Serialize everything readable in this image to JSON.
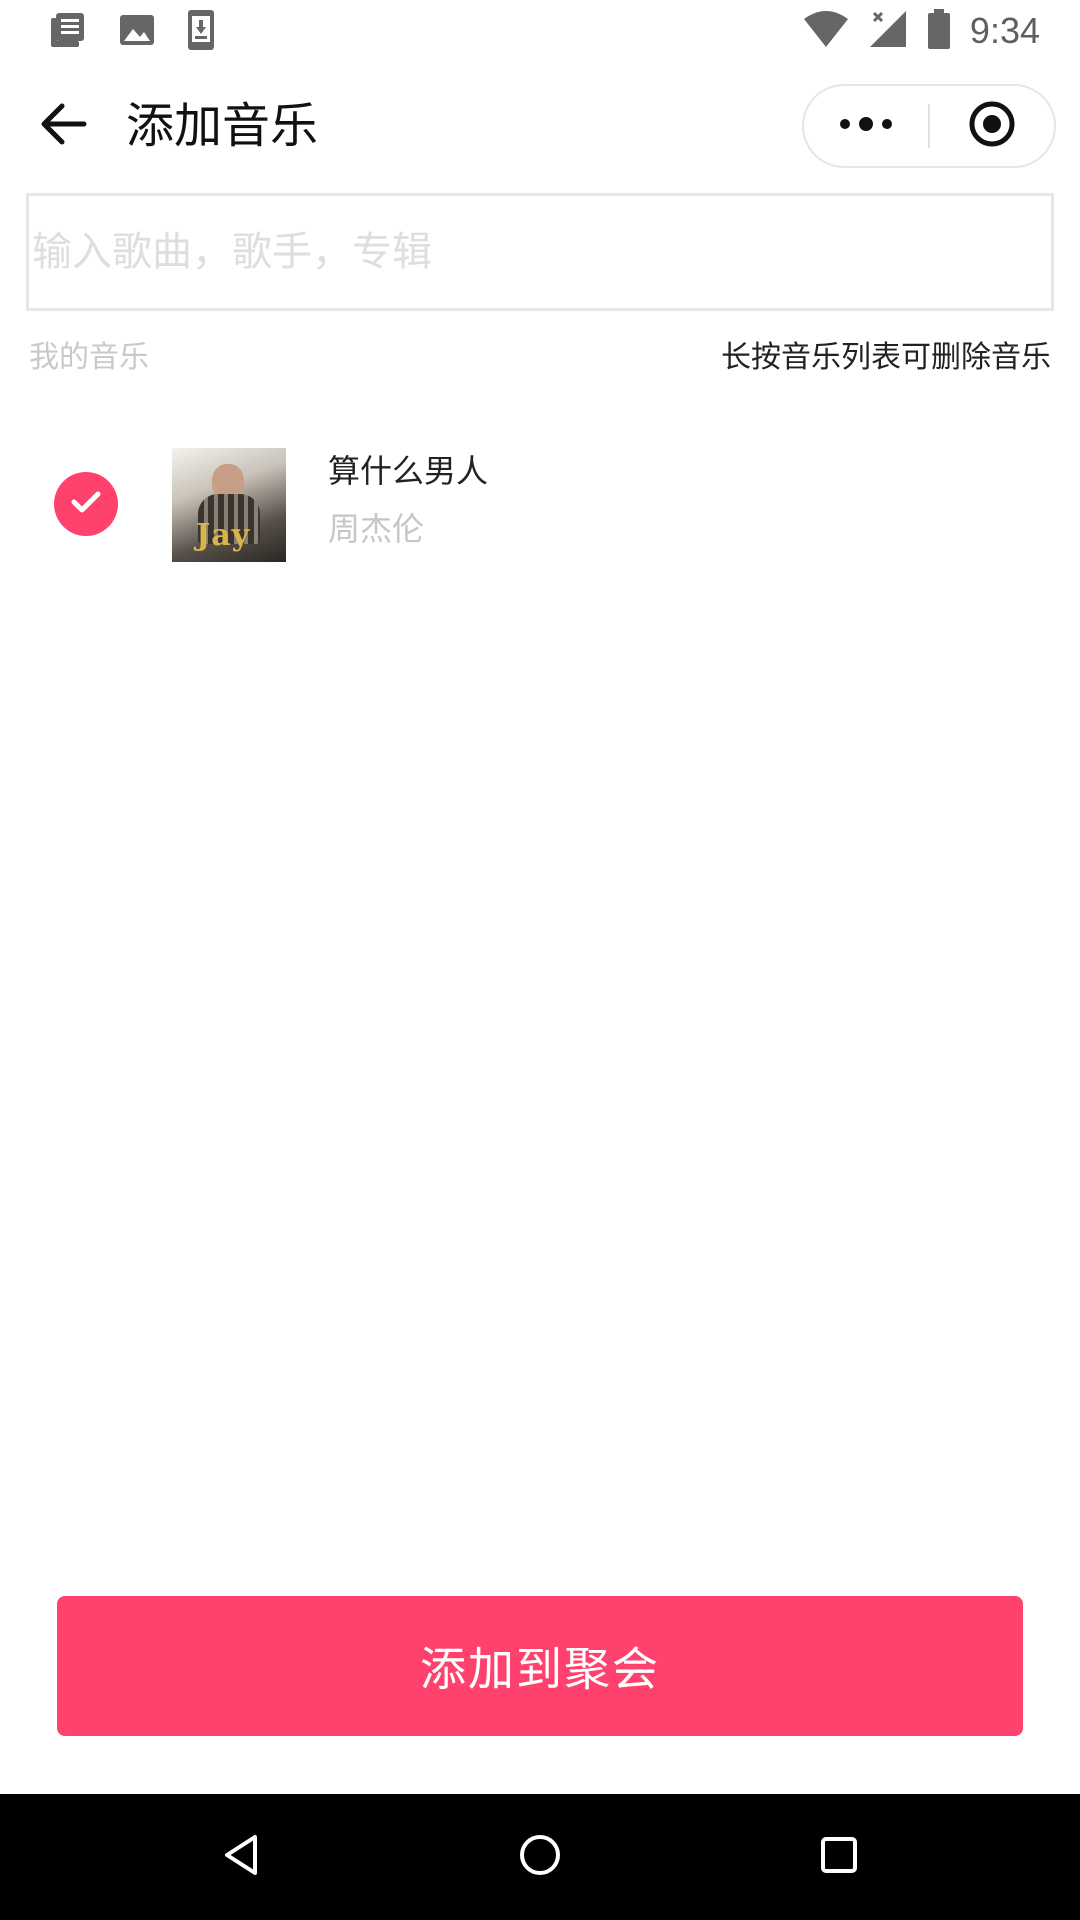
{
  "status_bar": {
    "time": "9:34",
    "left_icons": [
      "news-icon",
      "image-icon",
      "download-icon"
    ],
    "right_icons": [
      "wifi-icon",
      "signal-icon",
      "battery-icon"
    ]
  },
  "nav": {
    "title": "添加音乐",
    "back_icon": "arrow-left-icon",
    "menu_icon": "more-dots-icon",
    "close_icon": "target-circle-icon"
  },
  "search": {
    "placeholder": "输入歌曲，歌手，专辑",
    "value": ""
  },
  "section": {
    "label": "我的音乐",
    "hint": "长按音乐列表可删除音乐"
  },
  "songs": [
    {
      "title": "算什么男人",
      "artist": "周杰伦",
      "selected": true,
      "cover_text": "Jay"
    }
  ],
  "action": {
    "add_label": "添加到聚会"
  },
  "colors": {
    "accent": "#ff416d",
    "muted_text": "#c6c6c6",
    "border": "#e6e6e6"
  },
  "android_nav": [
    "back-triangle-icon",
    "home-circle-icon",
    "recents-square-icon"
  ]
}
